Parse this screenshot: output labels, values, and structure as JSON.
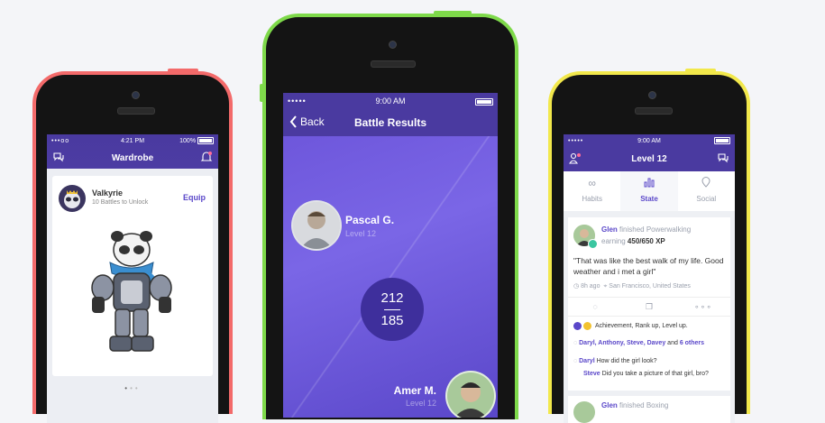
{
  "colors": {
    "phone_left": "#f36a6a",
    "phone_middle": "#7ed94a",
    "phone_right": "#f2e84b",
    "accent": "#5a47c9",
    "nav_dark": "#4a3aa0"
  },
  "wardrobe": {
    "status": {
      "signal": "•••oo",
      "time": "4:21 PM",
      "battery": "100%"
    },
    "title": "Wardrobe",
    "item_name": "Valkyrie",
    "item_subtitle": "10 Battles to Unlock",
    "equip_label": "Equip",
    "icons": {
      "left": "chat-bubbles-icon",
      "right": "bell-icon"
    }
  },
  "battle": {
    "status": {
      "signal": "•••••",
      "time": "9:00 AM"
    },
    "back_label": "Back",
    "title": "Battle Results",
    "player1": {
      "name": "Pascal G.",
      "level": "Level 12"
    },
    "player2": {
      "name": "Amer M.",
      "level": "Level 12"
    },
    "score_top": "212",
    "score_bottom": "185"
  },
  "feed": {
    "status": {
      "signal": "•••••",
      "time": "9:00 AM"
    },
    "title": "Level 12",
    "tabs": [
      {
        "label": "Habits",
        "icon": "infinity-icon"
      },
      {
        "label": "State",
        "icon": "bar-chart-icon"
      },
      {
        "label": "Social",
        "icon": "location-pin-icon"
      }
    ],
    "post1": {
      "user": "Glen",
      "action": "finished Powerwalking",
      "earning": "earning",
      "xp": "450/650 XP",
      "quote": "\"That was like the best walk of my life. Good weather and i met a girl\"",
      "time_ago": "8h ago",
      "location": "San Francisco, United States",
      "achievement": "Achievement, Rank up, Level up.",
      "likers": "Daryl, Anthony, Steve, Davey",
      "likers_and": "and",
      "likers_others": "6 others",
      "comment1_user": "Daryl",
      "comment1_text": "How did the girl look?",
      "comment2_user": "Steve",
      "comment2_text": "Did you take a picture of that girl, bro?"
    },
    "post2": {
      "user": "Glen",
      "action": "finished Boxing"
    }
  }
}
